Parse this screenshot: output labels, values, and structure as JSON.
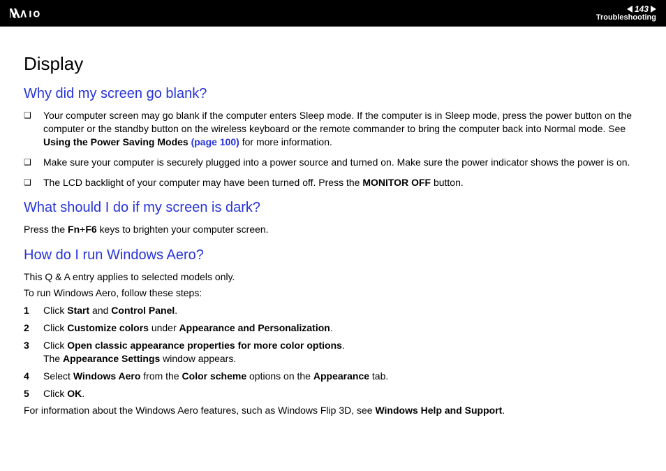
{
  "header": {
    "page_number": "143",
    "section": "Troubleshooting"
  },
  "title": "Display",
  "q1": {
    "heading": "Why did my screen go blank?",
    "bullets": [
      {
        "pre": "Your computer screen may go blank if the computer enters Sleep mode. If the computer is in Sleep mode, press the power button on the computer or the standby button on the wireless keyboard or the remote commander to bring the computer back into Normal mode. See ",
        "bold1": "Using the Power Saving Modes ",
        "link": "(page 100)",
        "post": " for more information."
      },
      {
        "text": "Make sure your computer is securely plugged into a power source and turned on. Make sure the power indicator shows the power is on."
      },
      {
        "pre": "The LCD backlight of your computer may have been turned off. Press the ",
        "bold1": "MONITOR OFF",
        "post": " button."
      }
    ]
  },
  "q2": {
    "heading": "What should I do if my screen is dark?",
    "para_pre": "Press the ",
    "para_bold": "Fn",
    "para_plus": "+",
    "para_bold2": "F6",
    "para_post": " keys to brighten your computer screen."
  },
  "q3": {
    "heading": "How do I run Windows Aero?",
    "intro1": "This Q & A entry applies to selected models only.",
    "intro2": "To run Windows Aero, follow these steps:",
    "steps": [
      {
        "n": "1",
        "pre": "Click ",
        "b1": "Start",
        "mid": " and ",
        "b2": "Control Panel",
        "post": "."
      },
      {
        "n": "2",
        "pre": "Click ",
        "b1": "Customize colors",
        "mid": " under ",
        "b2": "Appearance and Personalization",
        "post": "."
      },
      {
        "n": "3",
        "pre": "Click ",
        "b1": "Open classic appearance properties for more color options",
        "post": ".",
        "line2_pre": "The ",
        "line2_b": "Appearance Settings",
        "line2_post": " window appears."
      },
      {
        "n": "4",
        "pre": "Select ",
        "b1": "Windows Aero",
        "mid": " from the ",
        "b2": "Color scheme",
        "mid2": " options on the ",
        "b3": "Appearance",
        "post": " tab."
      },
      {
        "n": "5",
        "pre": "Click ",
        "b1": "OK",
        "post": "."
      }
    ],
    "outro_pre": "For information about the Windows Aero features, such as Windows Flip 3D, see ",
    "outro_bold": "Windows Help and Support",
    "outro_post": "."
  }
}
